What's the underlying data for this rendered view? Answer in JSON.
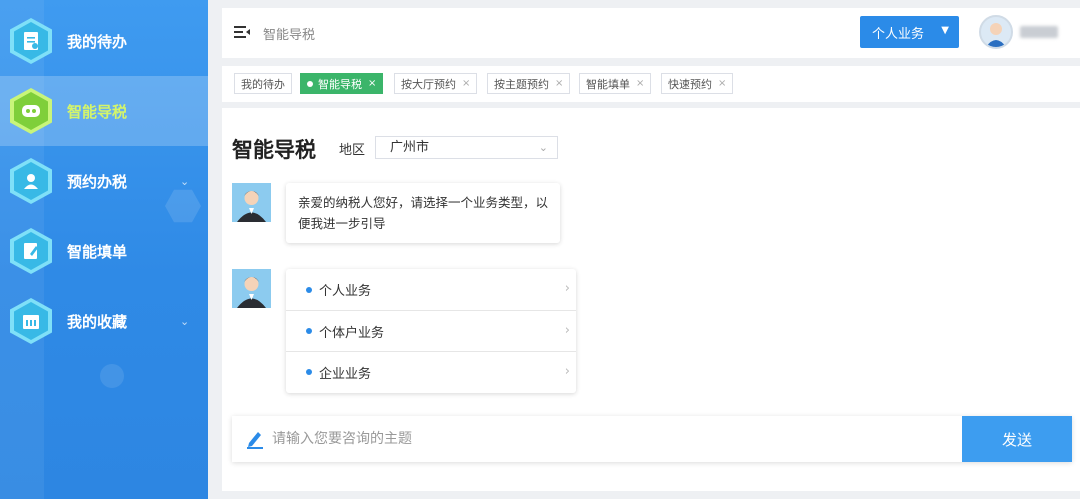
{
  "sidebar": {
    "items": [
      {
        "label": "我的待办",
        "icon": "document-icon",
        "active": false,
        "has_chevron": false
      },
      {
        "label": "智能导税",
        "icon": "robot-icon",
        "active": true,
        "has_chevron": false
      },
      {
        "label": "预约办税",
        "icon": "person-icon",
        "active": false,
        "has_chevron": true
      },
      {
        "label": "智能填单",
        "icon": "edit-form-icon",
        "active": false,
        "has_chevron": false
      },
      {
        "label": "我的收藏",
        "icon": "calendar-icon",
        "active": false,
        "has_chevron": true
      }
    ]
  },
  "header": {
    "title": "智能导税",
    "business_select": "个人业务",
    "user_name": "",
    "icons": [
      "menu-icon",
      "chevron-down-icon",
      "avatar"
    ]
  },
  "tabs": [
    {
      "label": "我的待办",
      "active": false,
      "closable": false
    },
    {
      "label": "智能导税",
      "active": true,
      "closable": true
    },
    {
      "label": "按大厅预约",
      "active": false,
      "closable": true
    },
    {
      "label": "按主题预约",
      "active": false,
      "closable": true
    },
    {
      "label": "智能填单",
      "active": false,
      "closable": true
    },
    {
      "label": "快速预约",
      "active": false,
      "closable": true
    }
  ],
  "tab_close": "×",
  "main": {
    "title": "智能导税",
    "region_label": "地区",
    "region_value": "广州市",
    "greeting": "亲爱的纳税人您好，请选择一个业务类型，以便我进一步引导",
    "options": [
      "个人业务",
      "个体户业务",
      "企业业务"
    ],
    "input_placeholder": "请输入您要咨询的主题",
    "send_label": "发送"
  },
  "colors": {
    "sidebar": "#2f8ae6",
    "active_tab": "#3bb56a",
    "primary_button": "#2b8be8",
    "send_button": "#3d9df0",
    "active_nav_text": "#d4f56a"
  }
}
